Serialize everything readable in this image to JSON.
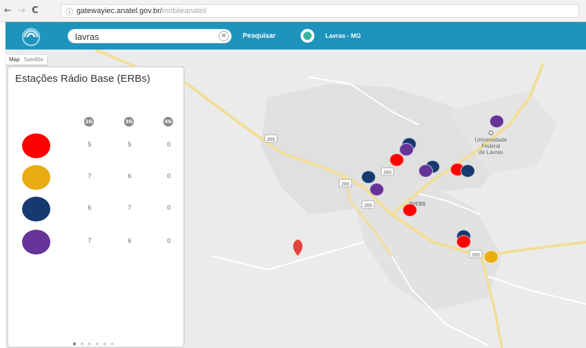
{
  "browser": {
    "back_glyph": "←",
    "forward_glyph": "→",
    "reload_glyph": "C",
    "info_glyph": "ⓘ",
    "url_host": "gatewayiec.anatel.gov.br/",
    "url_path": "mobileanatel/"
  },
  "header": {
    "search_value": "lavras",
    "clear_glyph": "✕",
    "search_button": "Pesquisar",
    "location_label": "Lavras - MG"
  },
  "map": {
    "type_map": "Map",
    "type_satellite": "Satellite",
    "road_labels": [
      "265",
      "265",
      "265",
      "265",
      "265"
    ],
    "place_label_1": "Universidade",
    "place_label_2": "Federal",
    "place_label_3": "de Lavras",
    "city_label": "avras"
  },
  "panel": {
    "title": "Estações Rádio Base (ERBs)",
    "columns": [
      "2G",
      "3G",
      "4G"
    ],
    "rows": [
      {
        "color": "#ff0000",
        "values": [
          "5",
          "5",
          "0"
        ]
      },
      {
        "color": "#e8ab10",
        "values": [
          "7",
          "6",
          "0"
        ]
      },
      {
        "color": "#163a70",
        "values": [
          "6",
          "7",
          "0"
        ]
      },
      {
        "color": "#663399",
        "values": [
          "7",
          "6",
          "0"
        ]
      }
    ],
    "pages": 6,
    "active_page": 0
  },
  "colors": {
    "header_blue": "#1e93bd",
    "red": "#ff0000",
    "yellow": "#e8ab10",
    "navy": "#163a70",
    "purple": "#663399",
    "pin": "#e2433c"
  }
}
